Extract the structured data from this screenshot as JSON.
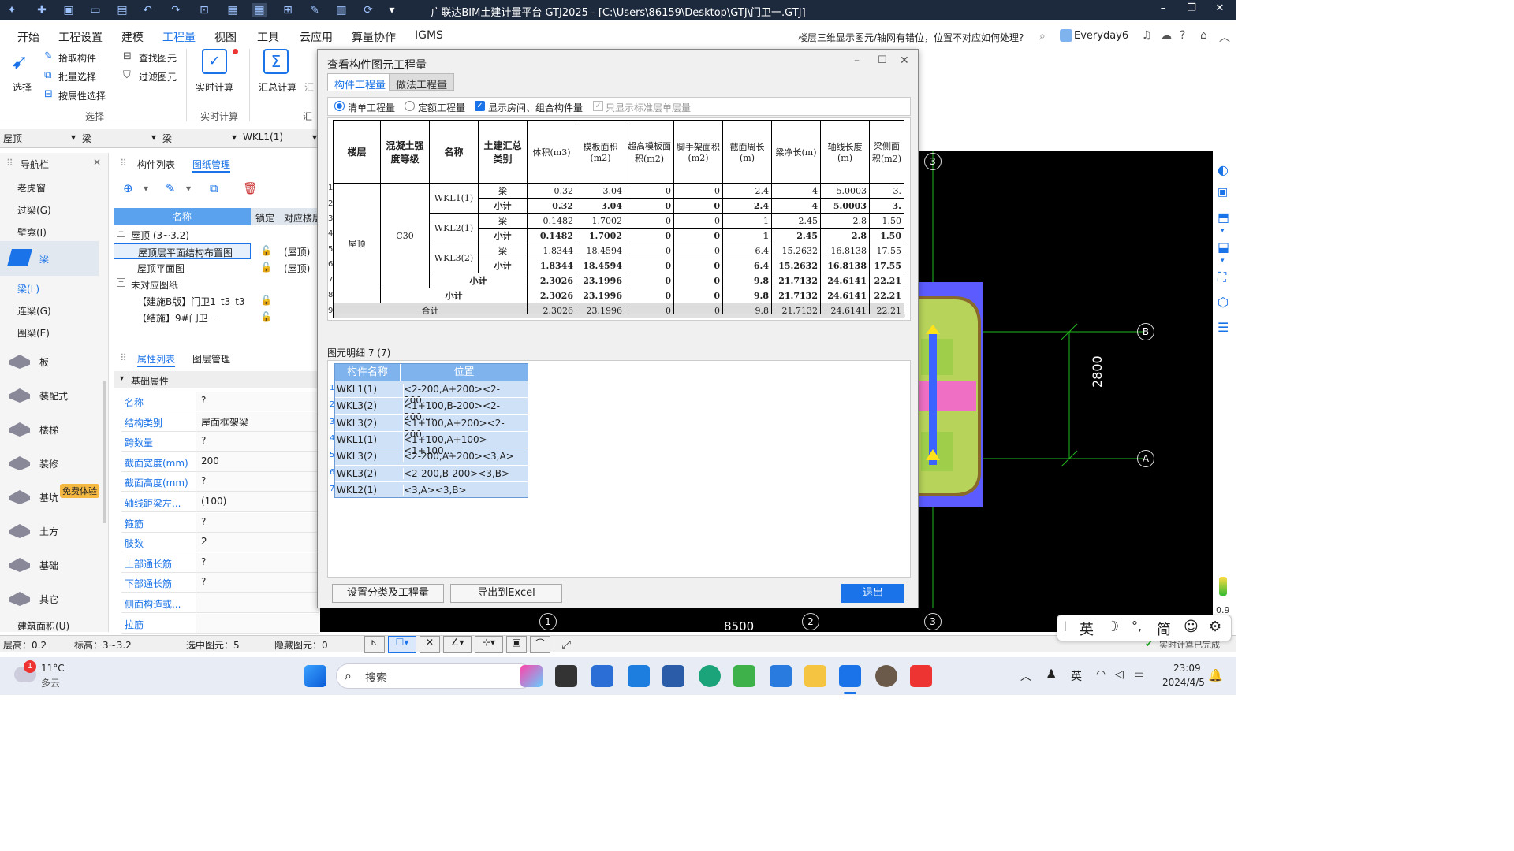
{
  "app": {
    "title": "广联达BIM土建计量平台 GTJ2025 - [C:\\Users\\86159\\Desktop\\GTJ\\门卫一.GTJ]",
    "dropdown_arrow": "▾"
  },
  "menu": [
    "开始",
    "工程设置",
    "建模",
    "工程量",
    "视图",
    "工具",
    "云应用",
    "算量协作",
    "IGMS"
  ],
  "menu_active": "工程量",
  "help_search": "楼层三维显示图元/轴网有错位，位置不对应如何处理?",
  "user": "Everyday6",
  "ribbon": {
    "select_label": "选择",
    "pick": "拾取构件",
    "batch": "批量选择",
    "by_attr": "按属性选择",
    "find": "查找图元",
    "filter": "过滤图元",
    "select_group": "选择",
    "realtime": "实时计算",
    "realtime_group": "实时计算",
    "summary": "汇总计算",
    "summary_short": "汇",
    "summary_group": "汇"
  },
  "selectors": [
    "屋顶",
    "梁",
    "梁",
    "WKL1(1)"
  ],
  "nav": {
    "title": "导航栏",
    "items_top": [
      "老虎窗",
      "过梁(G)",
      "壁龛(I)"
    ],
    "beam_cat": "梁",
    "beam_items": [
      "梁(L)",
      "连梁(G)",
      "圈梁(E)"
    ],
    "cats": [
      "板",
      "装配式",
      "楼梯",
      "装修",
      "基坑",
      "土方",
      "基础",
      "其它"
    ],
    "trial_badge": "免费体验",
    "bottom": "建筑面积(U)"
  },
  "tree": {
    "tabs": [
      "构件列表",
      "图纸管理"
    ],
    "headers": [
      "名称",
      "锁定",
      "对应楼层"
    ],
    "rows": [
      {
        "indent": 0,
        "name": "屋顶 (3~3.2)",
        "floor": ""
      },
      {
        "indent": 1,
        "name": "屋顶层平面结构布置图",
        "floor": "(屋顶)"
      },
      {
        "indent": 1,
        "name": "屋顶平面图",
        "floor": "(屋顶)"
      },
      {
        "indent": 0,
        "name": "未对应图纸",
        "floor": ""
      },
      {
        "indent": 1,
        "name": "【建施B版】门卫1_t3_t3",
        "floor": ""
      },
      {
        "indent": 1,
        "name": "【结施】9#门卫一",
        "floor": ""
      }
    ]
  },
  "props": {
    "tabs": [
      "属性列表",
      "图层管理"
    ],
    "group": "基础属性",
    "rows": [
      {
        "name": "名称",
        "value": "?"
      },
      {
        "name": "结构类别",
        "value": "屋面框架梁"
      },
      {
        "name": "跨数量",
        "value": "?"
      },
      {
        "name": "截面宽度(mm)",
        "value": "200"
      },
      {
        "name": "截面高度(mm)",
        "value": "?"
      },
      {
        "name": "轴线距梁左...",
        "value": "(100)"
      },
      {
        "name": "箍筋",
        "value": "?"
      },
      {
        "name": "肢数",
        "value": "2"
      },
      {
        "name": "上部通长筋",
        "value": "?"
      },
      {
        "name": "下部通长筋",
        "value": "?"
      },
      {
        "name": "侧面构造或...",
        "value": ""
      },
      {
        "name": "拉筋",
        "value": ""
      }
    ]
  },
  "dialog": {
    "title": "查看构件图元工程量",
    "tabs": [
      "构件工程量",
      "做法工程量"
    ],
    "opt_list": "清单工程量",
    "opt_quota": "定额工程量",
    "opt_show_room": "显示房间、组合构件量",
    "opt_std_only": "只显示标准层单层量",
    "headers": [
      "楼层",
      "混凝土强度等级",
      "名称",
      "土建汇总类别",
      "体积(m3)",
      "模板面积(m2)",
      "超高模板面积(m2)",
      "脚手架面积(m2)",
      "截面周长(m)",
      "梁净长(m)",
      "轴线长度(m)",
      "梁侧面积(m2)"
    ],
    "floor": "屋顶",
    "grade": "C30",
    "members": [
      {
        "name": "WKL1(1)",
        "rows": [
          [
            "梁",
            "0.32",
            "3.04",
            "0",
            "0",
            "2.4",
            "4",
            "5.0003",
            "3."
          ],
          [
            "小计",
            "0.32",
            "3.04",
            "0",
            "0",
            "2.4",
            "4",
            "5.0003",
            "3."
          ]
        ]
      },
      {
        "name": "WKL2(1)",
        "rows": [
          [
            "梁",
            "0.1482",
            "1.7002",
            "0",
            "0",
            "1",
            "2.45",
            "2.8",
            "1.50"
          ],
          [
            "小计",
            "0.1482",
            "1.7002",
            "0",
            "0",
            "1",
            "2.45",
            "2.8",
            "1.50"
          ]
        ]
      },
      {
        "name": "WKL3(2)",
        "rows": [
          [
            "梁",
            "1.8344",
            "18.4594",
            "0",
            "0",
            "6.4",
            "15.2632",
            "16.8138",
            "17.55"
          ],
          [
            "小计",
            "1.8344",
            "18.4594",
            "0",
            "0",
            "6.4",
            "15.2632",
            "16.8138",
            "17.55"
          ]
        ]
      }
    ],
    "grade_subtotal": [
      "小计",
      "2.3026",
      "23.1996",
      "0",
      "0",
      "9.8",
      "21.7132",
      "24.6141",
      "22.21"
    ],
    "floor_subtotal": [
      "小计",
      "2.3026",
      "23.1996",
      "0",
      "0",
      "9.8",
      "21.7132",
      "24.6141",
      "22.21"
    ],
    "total": [
      "合计",
      "2.3026",
      "23.1996",
      "0",
      "0",
      "9.8",
      "21.7132",
      "24.6141",
      "22.21"
    ],
    "row_numbers": [
      "1",
      "2",
      "3",
      "4",
      "5",
      "6",
      "7",
      "8",
      "9"
    ],
    "detail_title": "图元明细",
    "detail_count": "7 (7)",
    "detail_headers": [
      "构件名称",
      "位置"
    ],
    "detail_rows": [
      {
        "n": "1",
        "name": "WKL1(1)",
        "pos": "<2-200,A+200><2-200,..."
      },
      {
        "n": "2",
        "name": "WKL3(2)",
        "pos": "<1+100,B-200><2-200,..."
      },
      {
        "n": "3",
        "name": "WKL3(2)",
        "pos": "<1+100,A+200><2-200,..."
      },
      {
        "n": "4",
        "name": "WKL1(1)",
        "pos": "<1+100,A+100><1+100..."
      },
      {
        "n": "5",
        "name": "WKL3(2)",
        "pos": "<2-200,A+200><3,A>"
      },
      {
        "n": "6",
        "name": "WKL3(2)",
        "pos": "<2-200,B-200><3,B>"
      },
      {
        "n": "7",
        "name": "WKL2(1)",
        "pos": "<3,A><3,B>"
      }
    ],
    "btn_set": "设置分类及工程量",
    "btn_export": "导出到Excel",
    "btn_exit": "退出"
  },
  "cad": {
    "axis_top": "3",
    "axis_b": "B",
    "axis_a": "A",
    "dim_2800": "2800",
    "axis_1": "1",
    "axis_2": "2",
    "axis_3b": "3",
    "dim_8500": "8500",
    "calc_done": "实时计算已完成",
    "zoom": "0.9"
  },
  "status": {
    "floor_h": "层高：0.2",
    "elev": "标高：3~3.2",
    "selected": "选中图元：5",
    "hidden": "隐藏图元：0"
  },
  "ime": [
    "英",
    "☽",
    "°,",
    "简",
    "☺",
    "⚙"
  ],
  "taskbar": {
    "weather_temp": "11°C",
    "weather_desc": "多云",
    "weather_badge": "1",
    "search": "搜索",
    "lang": "英",
    "time": "23:09",
    "date": "2024/4/5"
  },
  "colors": {
    "accent": "#1a73e8",
    "titlebar": "#1d2a3d",
    "exit_btn": "#1a73e8"
  }
}
